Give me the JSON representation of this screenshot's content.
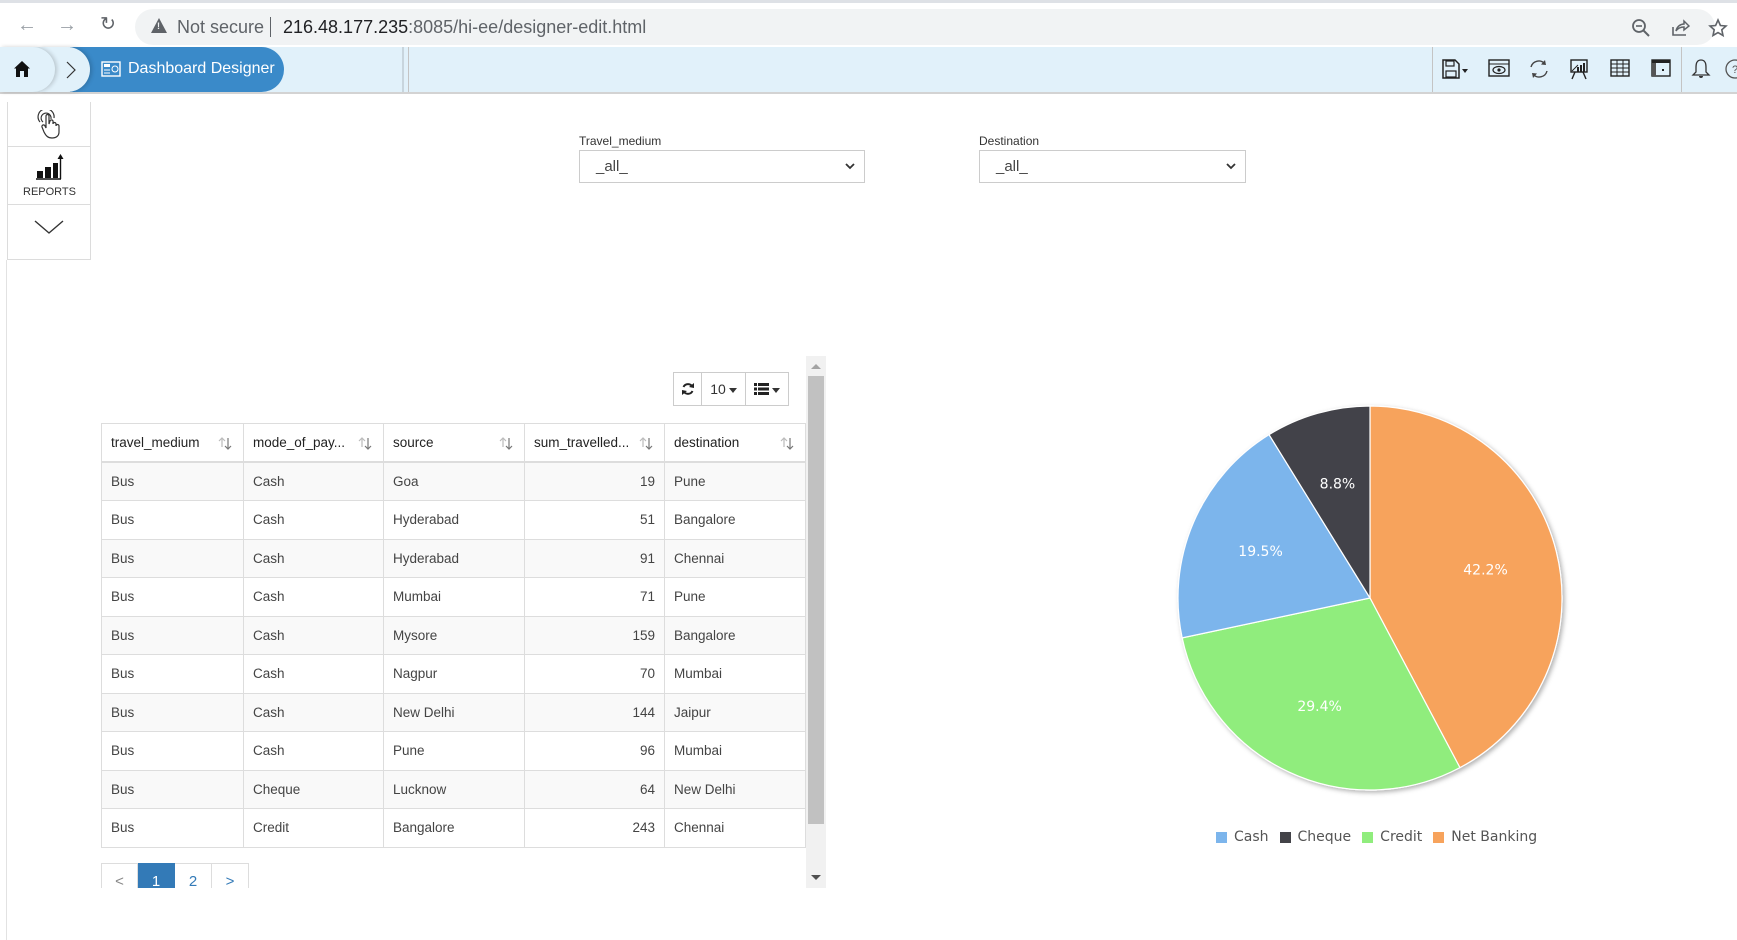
{
  "browser": {
    "security_label": "Not secure",
    "url_host": "216.48.177.235",
    "url_rest": ":8085/hi-ee/designer-edit.html"
  },
  "header": {
    "breadcrumb_label": "Dashboard Designer",
    "toolbar_icons": [
      "save-icon",
      "preview-icon",
      "refresh-icon",
      "presentation-icon",
      "table-icon",
      "panel-icon",
      "bell-icon",
      "help-icon"
    ]
  },
  "sidebar": {
    "items": [
      {
        "icon": "touch-icon",
        "label": ""
      },
      {
        "icon": "reports-icon",
        "label": "REPORTS"
      },
      {
        "icon": "chevron-down-icon",
        "label": ""
      }
    ]
  },
  "filters": [
    {
      "label": "Travel_medium",
      "value": "_all_"
    },
    {
      "label": "Destination",
      "value": "_all_"
    }
  ],
  "table_toolbar": {
    "page_size": "10"
  },
  "table": {
    "columns": [
      "travel_medium",
      "mode_of_pay...",
      "source",
      "sum_travelled...",
      "destination"
    ],
    "rows": [
      [
        "Bus",
        "Cash",
        "Goa",
        "19",
        "Pune"
      ],
      [
        "Bus",
        "Cash",
        "Hyderabad",
        "51",
        "Bangalore"
      ],
      [
        "Bus",
        "Cash",
        "Hyderabad",
        "91",
        "Chennai"
      ],
      [
        "Bus",
        "Cash",
        "Mumbai",
        "71",
        "Pune"
      ],
      [
        "Bus",
        "Cash",
        "Mysore",
        "159",
        "Bangalore"
      ],
      [
        "Bus",
        "Cash",
        "Nagpur",
        "70",
        "Mumbai"
      ],
      [
        "Bus",
        "Cash",
        "New Delhi",
        "144",
        "Jaipur"
      ],
      [
        "Bus",
        "Cash",
        "Pune",
        "96",
        "Mumbai"
      ],
      [
        "Bus",
        "Cheque",
        "Lucknow",
        "64",
        "New Delhi"
      ],
      [
        "Bus",
        "Credit",
        "Bangalore",
        "243",
        "Chennai"
      ]
    ]
  },
  "pagination": {
    "prev": "<",
    "pages": [
      "1",
      "2"
    ],
    "active_page": "1",
    "next": ">"
  },
  "chart_data": {
    "type": "pie",
    "title": "",
    "legend_position": "bottom",
    "categories": [
      "Cash",
      "Cheque",
      "Credit",
      "Net Banking"
    ],
    "values": [
      19.5,
      8.8,
      29.4,
      42.2
    ],
    "labels": [
      "19.5%",
      "8.8%",
      "29.4%",
      "42.2%"
    ],
    "colors": [
      "#7cb5ec",
      "#434348",
      "#90ed7d",
      "#f7a35c"
    ],
    "draw_order_clockwise_from_top": [
      "Net Banking",
      "Credit",
      "Cash",
      "Cheque"
    ]
  }
}
